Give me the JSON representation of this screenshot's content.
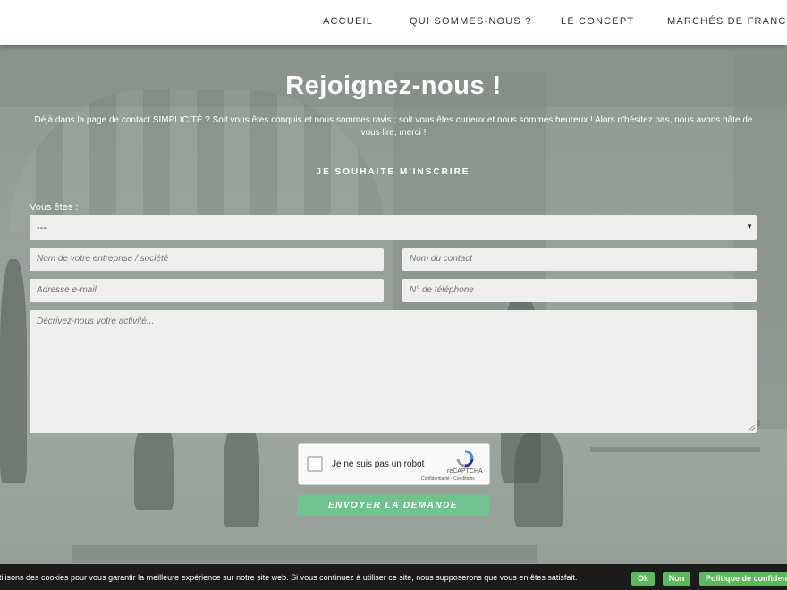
{
  "nav": {
    "items": [
      {
        "label": "ACCUEIL"
      },
      {
        "label": "QUI SOMMES-NOUS ?"
      },
      {
        "label": "LE CONCEPT"
      },
      {
        "label": "MARCHÉS DE FRANCE"
      }
    ]
  },
  "main": {
    "title": "Rejoignez-nous !",
    "intro": "Déjà dans la page de contact SIMPLICITÉ ? Soit vous êtes conquis et nous sommes ravis ; soit vous êtes curieux et nous sommes heureux ! Alors n'hésitez pas, nous avons hâte de vous lire, merci !",
    "section_heading": "JE SOUHAITE M'INSCRIRE"
  },
  "form": {
    "type_label": "Vous êtes :",
    "type_selected": "---",
    "company_placeholder": "Nom de votre entreprise / société",
    "contact_placeholder": "Nom du contact",
    "email_placeholder": "Adresse e-mail",
    "phone_placeholder": "N° de téléphone",
    "activity_placeholder": "Décrivez-nous votre activité...",
    "submit_label": "ENVOYER LA DEMANDE"
  },
  "captcha": {
    "label": "Je ne suis pas un robot",
    "brand": "reCAPTCHA",
    "terms": "Confidentialité - Conditions"
  },
  "cookie": {
    "text": "utilisons des cookies pour vous garantir la meilleure expérience sur notre site web. Si vous continuez à utiliser ce site, nous supposerons que vous en êtes satisfait.",
    "ok_label": "Ok",
    "no_label": "Non",
    "policy_label": "Politique de confidentialité"
  },
  "colors": {
    "accent": "#6ec38e",
    "cookie_button": "#5cb85c",
    "nav_bg": "#ffffff"
  }
}
